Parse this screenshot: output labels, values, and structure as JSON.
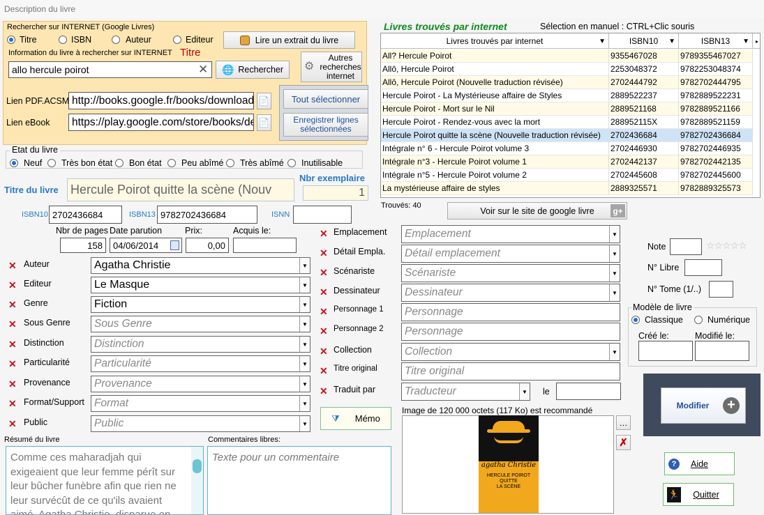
{
  "window": {
    "title": "Description du livre"
  },
  "search": {
    "group_label": "Rechercher sur INTERNET (Google Livres)",
    "options": [
      "Titre",
      "ISBN",
      "Auteur",
      "Editeur"
    ],
    "selected": 0,
    "extract_button": "Lire un extrait du livre",
    "info_label": "Information du livre à rechercher sur INTERNET",
    "info_type": "Titre",
    "query": "allo hercule poirot",
    "search_button": "Rechercher",
    "other_button": "Autres recherches internet",
    "pdf_label": "Lien PDF.ACSM",
    "pdf_value": "http://books.google.fr/books/download/",
    "ebook_label": "Lien eBook",
    "ebook_value": "https://play.google.com/store/books/de",
    "select_all": "Tout sélectionner",
    "save_selected": "Enregistrer lignes sélectionnées"
  },
  "condition": {
    "label": "Etat du livre",
    "options": [
      "Neuf",
      "Très bon état",
      "Bon état",
      "Peu abîmé",
      "Très abîmé",
      "Inutilisable"
    ],
    "selected": 0
  },
  "book": {
    "title_label": "Titre du livre",
    "title_value": "Hercule Poirot quitte la scène (Nouv",
    "copies_label": "Nbr exemplaire",
    "copies_value": "1",
    "isbn10_label": "ISBN10",
    "isbn10": "2702436684",
    "isbn13_label": "ISBN13",
    "isbn13": "9782702436684",
    "issn_label": "ISNN",
    "issn": "",
    "pages_label": "Nbr de pages",
    "pages": "158",
    "date_label": "Date parution",
    "date": "04/06/2014",
    "price_label": "Prix:",
    "price": "0,00",
    "acquired_label": "Acquis le:",
    "acquired": ""
  },
  "left_fields": [
    {
      "label": "Auteur",
      "value": "Agatha Christie",
      "placeholder": false
    },
    {
      "label": "Editeur",
      "value": "Le Masque",
      "placeholder": false
    },
    {
      "label": "Genre",
      "value": "Fiction",
      "placeholder": false
    },
    {
      "label": "Sous Genre",
      "value": "Sous Genre",
      "placeholder": true
    },
    {
      "label": "Distinction",
      "value": "Distinction",
      "placeholder": true
    },
    {
      "label": "Particularité",
      "value": "Particularité",
      "placeholder": true
    },
    {
      "label": "Provenance",
      "value": "Provenance",
      "placeholder": true
    },
    {
      "label": "Format/Support",
      "value": "Format",
      "placeholder": true
    },
    {
      "label": "Public",
      "value": "Public",
      "placeholder": true
    }
  ],
  "mid_fields": [
    {
      "label": "Emplacement",
      "value": "Emplacement"
    },
    {
      "label": "Détail Empla.",
      "value": "Détail emplacement"
    },
    {
      "label": "Scénariste",
      "value": "Scénariste"
    },
    {
      "label": "Dessinateur",
      "value": "Dessinateur"
    },
    {
      "label": "Personnage 1",
      "value": "Personnage"
    },
    {
      "label": "Personnage 2",
      "value": "Personnage"
    },
    {
      "label": "Collection",
      "value": "Collection"
    },
    {
      "label": "Titre original",
      "value": "Titre original"
    },
    {
      "label": "Traduit par",
      "value": "Traducteur"
    }
  ],
  "translated_le": "le",
  "memo_button": "Mémo",
  "image_hint": "Image de 120 000 octets (117 Ko) est recommandé",
  "cover": {
    "brand": "agatha Christie",
    "line1": "HERCULE POIROT",
    "line2": "QUITTE",
    "line3": "LA SCÈNE"
  },
  "results": {
    "title": "Livres trouvés par internet",
    "hint": "Sélection en manuel : CTRL+Clic souris",
    "columns": [
      "Livres trouvés par internet",
      "ISBN10",
      "ISBN13"
    ],
    "rows": [
      [
        "All? Hercule Poirot",
        "9355467028",
        "9789355467027"
      ],
      [
        "Allô, Hercule Poirot",
        "2253048372",
        "9782253048374"
      ],
      [
        "Allô, Hercule Poirot (Nouvelle traduction révisée)",
        "2702444792",
        "9782702444795"
      ],
      [
        "Hercule Poirot - La Mystérieuse affaire de Styles",
        "2889522237",
        "9782889522231"
      ],
      [
        "Hercule Poirot - Mort sur le Nil",
        "2889521168",
        "9782889521166"
      ],
      [
        "Hercule Poirot - Rendez-vous avec la mort",
        "288952115X",
        "9782889521159"
      ],
      [
        "Hercule Poirot quitte la scène (Nouvelle traduction révisée)",
        "2702436684",
        "9782702436684"
      ],
      [
        "Intégrale n° 6 - Hercule Poirot volume 3",
        "2702446930",
        "9782702446935"
      ],
      [
        "Intégrale n°3 - Hercule Poirot volume 1",
        "2702442137",
        "9782702442135"
      ],
      [
        "Intégrale n°5 - Hercule Poirot volume 2",
        "2702445608",
        "9782702445600"
      ],
      [
        "La mystérieuse affaire de styles",
        "2889325571",
        "9782889325573"
      ]
    ],
    "selected_row": 6,
    "found": "Trouvés: 40",
    "google_button": "Voir sur le site de google livre"
  },
  "right": {
    "note_label": "Note",
    "libre_label": "N° Libre",
    "tome_label": "N° Tome (1/..)",
    "model_label": "Modèle de livre",
    "model_options": [
      "Classique",
      "Numérique"
    ],
    "model_selected": 0,
    "created_label": "Créé le:",
    "modified_label": "Modifié le:",
    "modify_button": "Modifier",
    "help_button": "Aide",
    "quit_button": "Quitter"
  },
  "summary": {
    "label": "Résumé du livre",
    "text": "Comme ces maharadjah qui exigeaient que leur femme pérît sur leur bûcher funèbre afin que rien ne leur survécût de ce qu'ils avaient aimé, Agatha Christie, disparue en"
  },
  "comments": {
    "label": "Commentaires libres:",
    "placeholder": "Texte pour un commentaire"
  },
  "colors": {
    "orange_panel": "#fde6b2",
    "title_green": "#0d8a1e",
    "label_blue": "#2a78c6",
    "red_x": "#c8141e",
    "selected_row": "#cfe3f7",
    "row_alt": "#fffbe6"
  }
}
